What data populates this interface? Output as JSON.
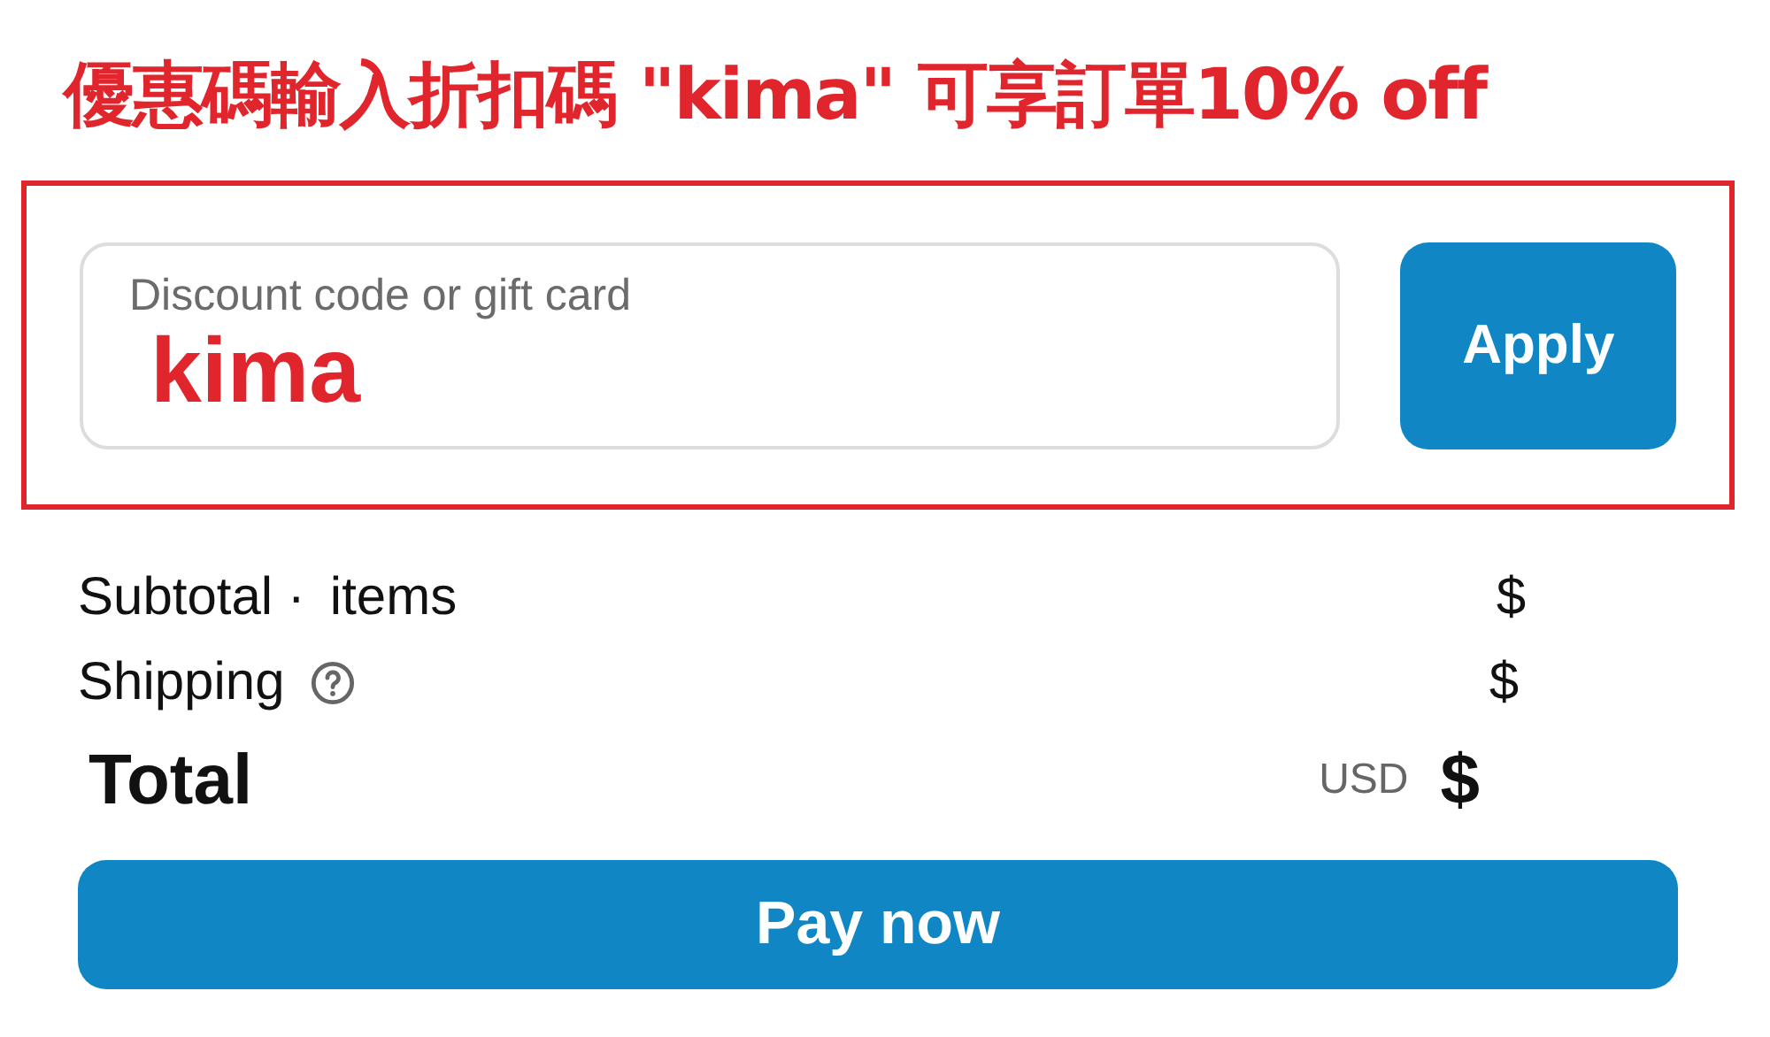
{
  "banner": {
    "text": "優惠碼輸入折扣碼 \"kima\" 可享訂單10% off"
  },
  "discount": {
    "placeholder": "Discount code or gift card",
    "value": "kima",
    "button": "Apply"
  },
  "summary": [
    {
      "kind": "subtotal",
      "label": "Subtotal ·",
      "extra": "items",
      "amount": "$"
    },
    {
      "kind": "shipping",
      "label": "Shipping",
      "amount": "$"
    }
  ],
  "total": {
    "label": "Total",
    "currency": "USD",
    "amount": "$"
  },
  "pay_button": "Pay now"
}
